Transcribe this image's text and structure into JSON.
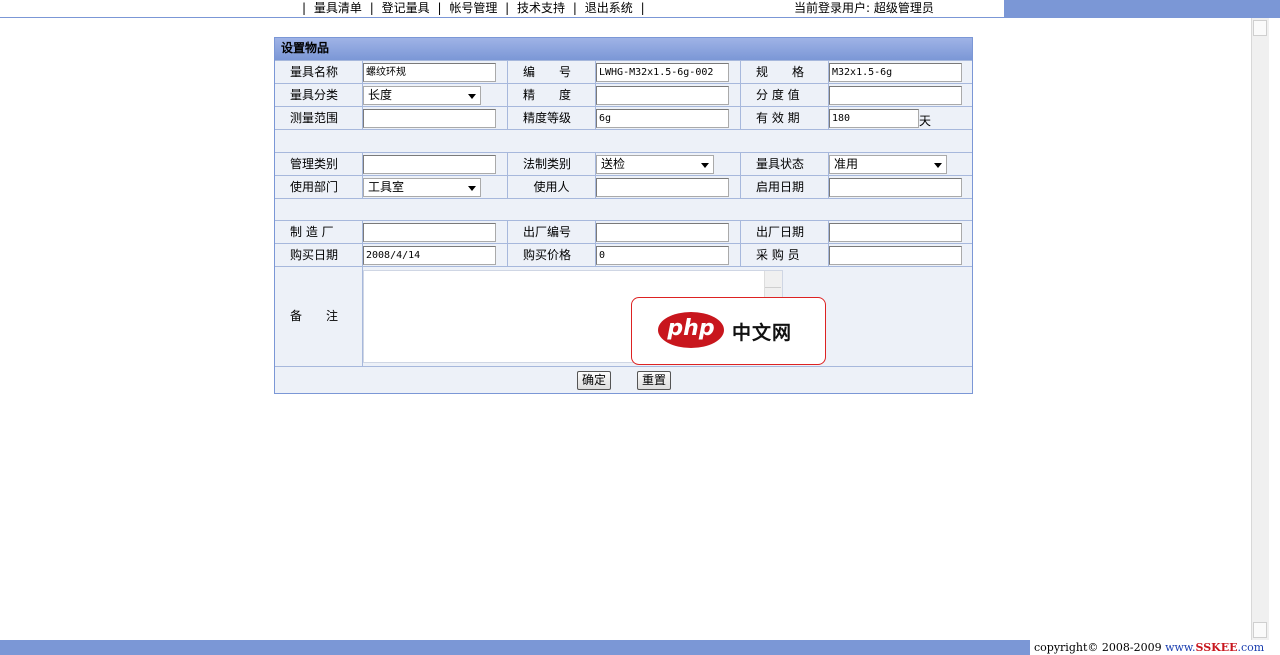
{
  "nav": {
    "items": [
      "量具清单",
      "登记量具",
      "帐号管理",
      "技术支持",
      "退出系统"
    ],
    "separator": "|"
  },
  "user_info": "当前登录用户: 超级管理员",
  "form": {
    "title": "设置物品",
    "rows": [
      [
        {
          "label": "量具名称",
          "value": "螺纹环规",
          "kind": "input"
        },
        {
          "label": "编　　号",
          "value": "LWHG-M32x1.5-6g-002",
          "kind": "input"
        },
        {
          "label": "规　　格",
          "value": "M32x1.5-6g",
          "kind": "input"
        }
      ],
      [
        {
          "label": "量具分类",
          "value": "长度",
          "kind": "select"
        },
        {
          "label": "精　　度",
          "value": "",
          "kind": "input"
        },
        {
          "label": "分 度 值",
          "value": "",
          "kind": "input"
        }
      ],
      [
        {
          "label": "测量范围",
          "value": "",
          "kind": "input"
        },
        {
          "label": "精度等级",
          "value": "6g",
          "kind": "input"
        },
        {
          "label": "有 效 期",
          "value": "180",
          "kind": "input",
          "suffix": "天"
        }
      ],
      [
        {
          "label": "管理类别",
          "value": "",
          "kind": "input"
        },
        {
          "label": "法制类别",
          "value": "送检",
          "kind": "select"
        },
        {
          "label": "量具状态",
          "value": "准用",
          "kind": "select"
        }
      ],
      [
        {
          "label": "使用部门",
          "value": "工具室",
          "kind": "select"
        },
        {
          "label": "使用人",
          "value": "",
          "kind": "input"
        },
        {
          "label": "启用日期",
          "value": "",
          "kind": "input"
        }
      ],
      [
        {
          "label": "制 造 厂",
          "value": "",
          "kind": "input"
        },
        {
          "label": "出厂编号",
          "value": "",
          "kind": "input"
        },
        {
          "label": "出厂日期",
          "value": "",
          "kind": "input"
        }
      ],
      [
        {
          "label": "购买日期",
          "value": "2008/4/14",
          "kind": "input"
        },
        {
          "label": "购买价格",
          "value": "0",
          "kind": "input"
        },
        {
          "label": "采 购 员",
          "value": "",
          "kind": "input"
        }
      ]
    ],
    "remark_label": "备　　注",
    "remark_value": "",
    "confirm_label": "确定",
    "reset_label": "重置"
  },
  "watermark": {
    "badge": "php",
    "text": "中文网"
  },
  "footer": {
    "copyright": "copyright© 2008-2009 ",
    "www": "www.",
    "brand": "SSKEE",
    "tld": ".com"
  },
  "colors": {
    "accent": "#7b97d6",
    "panel_bg": "#edf1f8",
    "brand_red": "#c8161d"
  }
}
